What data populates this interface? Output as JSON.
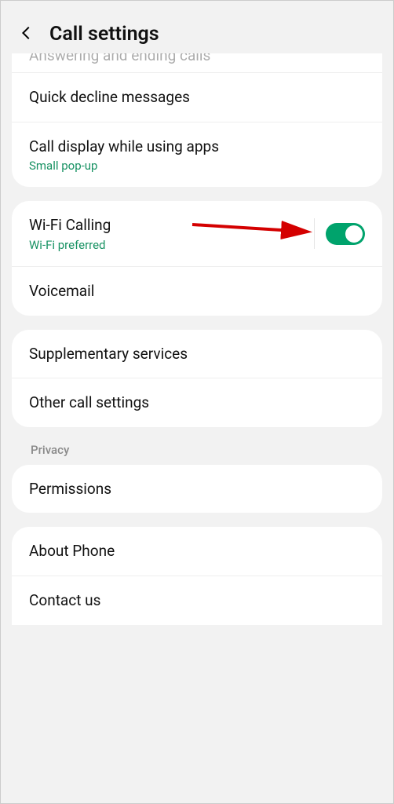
{
  "header": {
    "title": "Call settings"
  },
  "group1": {
    "truncated_top": "Answering and ending calls",
    "quick_decline": "Quick decline messages",
    "call_display": {
      "label": "Call display while using apps",
      "sub": "Small pop-up"
    }
  },
  "group2": {
    "wifi_calling": {
      "label": "Wi-Fi Calling",
      "sub": "Wi-Fi preferred",
      "enabled": true
    },
    "voicemail": "Voicemail"
  },
  "group3": {
    "supplementary": "Supplementary services",
    "other": "Other call settings"
  },
  "privacy": {
    "section_label": "Privacy",
    "permissions": "Permissions"
  },
  "group5": {
    "about": "About Phone",
    "contact": "Contact us"
  }
}
